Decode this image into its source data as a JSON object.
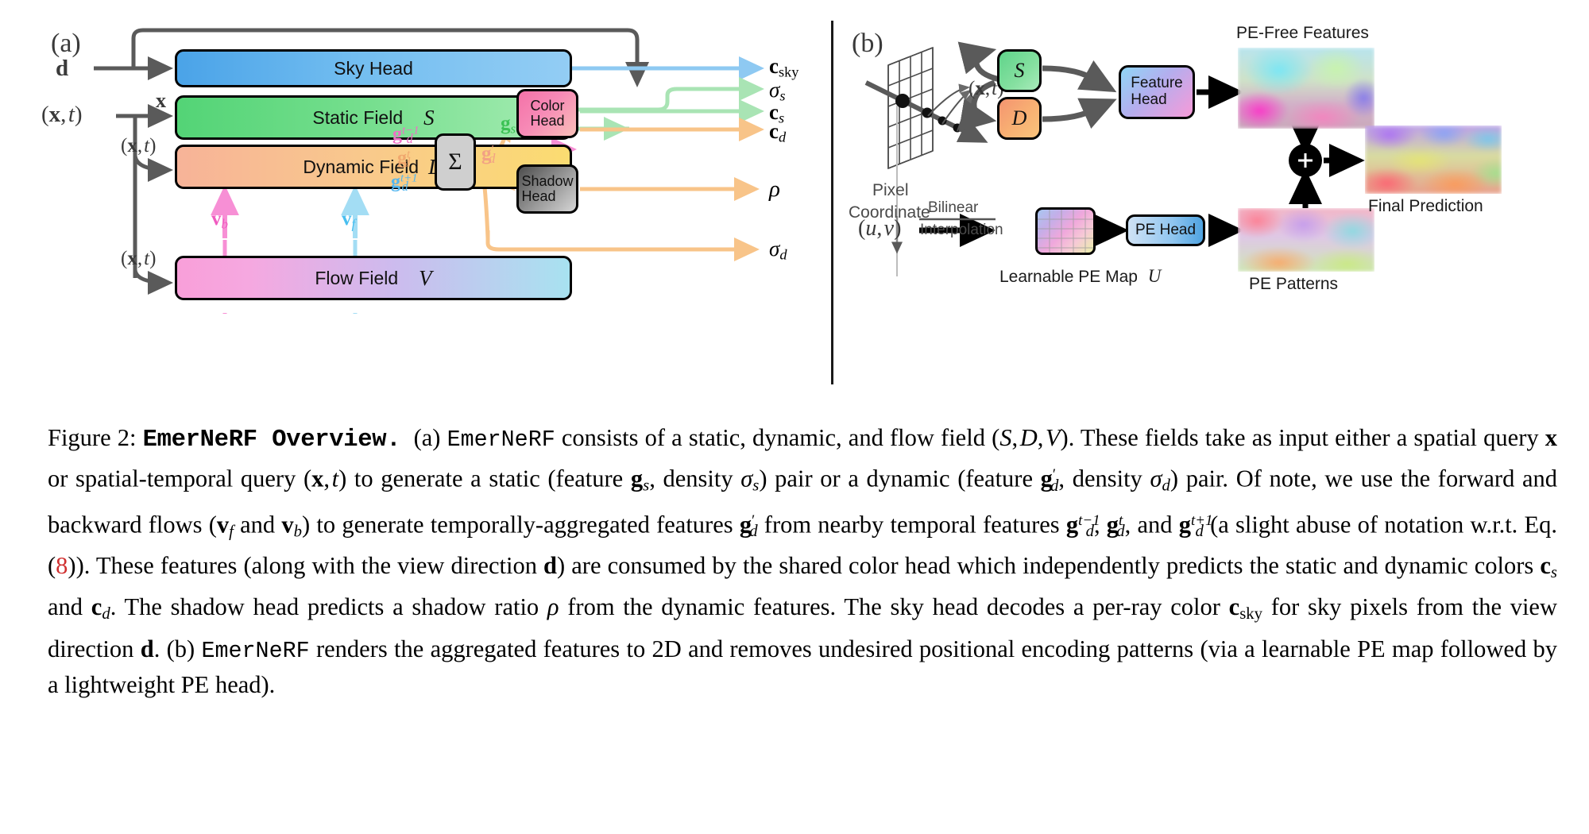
{
  "figure": {
    "panel_a": {
      "tag": "(a)",
      "inputs": [
        {
          "name": "direction",
          "latex": "d"
        },
        {
          "name": "spatio-temporal-query-static",
          "latex": "(x, t)"
        },
        {
          "name": "spatio-temporal-query-dynamic",
          "latex": "(x, t)"
        },
        {
          "name": "spatio-temporal-query-flow",
          "latex": "(x, t)"
        }
      ],
      "edge_labels": {
        "x_to_static": "x",
        "g_s": "g_s",
        "g_d_tm1": "g_d^{t-1}",
        "g_d_t": "g_d^{t}",
        "g_d_tp1": "g_d^{t+1}",
        "g_d_prime": "g'_d",
        "v_b": "v_b",
        "v_f": "v_f"
      },
      "boxes": [
        {
          "id": "sky-head",
          "label": "Sky Head",
          "symbol": ""
        },
        {
          "id": "static-field",
          "label": "Static Field",
          "symbol": "S"
        },
        {
          "id": "dynamic-field",
          "label": "Dynamic Field",
          "symbol": "D"
        },
        {
          "id": "flow-field",
          "label": "Flow Field",
          "symbol": "V"
        },
        {
          "id": "sigma-box",
          "label": "Σ",
          "symbol": ""
        },
        {
          "id": "color-head",
          "label": "Color Head",
          "symbol": ""
        },
        {
          "id": "shadow-head",
          "label": "Shadow Head",
          "symbol": ""
        }
      ],
      "outputs": [
        {
          "name": "c-sky",
          "base": "c",
          "sub": "sky"
        },
        {
          "name": "sigma-s",
          "base": "σ",
          "sub": "s"
        },
        {
          "name": "c-s",
          "base": "c",
          "sub": "s"
        },
        {
          "name": "c-d",
          "base": "c",
          "sub": "d"
        },
        {
          "name": "rho",
          "base": "ρ",
          "sub": ""
        },
        {
          "name": "sigma-d",
          "base": "σ",
          "sub": "d"
        }
      ]
    },
    "panel_b": {
      "tag": "(b)",
      "pixel_coordinate_label_line1": "Pixel",
      "pixel_coordinate_label_line2": "Coordinate",
      "sample_query_label": "(x, t)",
      "uv_label": "(u, v)",
      "bilinear_top": "Bilinear",
      "bilinear_bottom": "Interpolation",
      "boxes": [
        {
          "id": "b-static",
          "label": "S"
        },
        {
          "id": "b-dynamic",
          "label": "D"
        },
        {
          "id": "feature-head",
          "label": "Feature Head"
        },
        {
          "id": "pe-head",
          "label": "PE Head"
        }
      ],
      "image_captions": {
        "pe_free": "PE-Free Features",
        "final_prediction": "Final Prediction",
        "pe_patterns": "PE Patterns",
        "learnable_pe_map": "Learnable PE Map",
        "learnable_pe_map_symbol": "U"
      },
      "plus_symbol": "+"
    },
    "colors": {
      "sky_blue": "#7cc3f0",
      "static_green": "#77df8f",
      "dynamic_orange": "#f9c98c",
      "flow_pink": "#f89fd9",
      "color_head_pink": "#f478ac",
      "shadow_head_gray": "#8d8d8d",
      "arrow_gray": "#5a5a5a",
      "flow_backward_magenta": "#f77fce",
      "flow_forward_cyan": "#8fd9f4",
      "citation_red": "#d03030"
    }
  },
  "caption": {
    "figure_number": "Figure 2:",
    "title": "EmerNeRF Overview.",
    "text_parts": [
      "(a) ",
      "EmerNeRF",
      " consists of a static, dynamic, and flow field (",
      "S, D, V",
      "). These fields take as input either a spatial query ",
      "x",
      " or spatial-temporal query ",
      "(x, t)",
      " to generate a static (feature ",
      "g_s",
      ", density ",
      "σ_s",
      ") pair or a dynamic (feature ",
      "g'_d",
      ", density ",
      "σ_d",
      ") pair. Of note, we use the forward and backward flows (",
      "v_f",
      " and ",
      "v_b",
      ") to generate temporally-aggregated features ",
      "g'_d",
      " from nearby temporal features ",
      "g_d^{t-1}, g_d^{t}",
      ", and ",
      "g_d^{t+1}",
      " (a slight abuse of notation w.r.t. Eq. (",
      "8",
      ")). These features (along with the view direction ",
      "d",
      ") are consumed by the shared color head which independently predicts the static and dynamic colors ",
      "c_s",
      " and ",
      "c_d",
      ". The shadow head predicts a shadow ratio ",
      "ρ",
      " from the dynamic features. The sky head decodes a per-ray color ",
      "c_sky",
      " for sky pixels from the view direction ",
      "d",
      ". (b) ",
      "EmerNeRF",
      " renders the aggregated features to 2D and removes undesired positional encoding patterns (via a learnable PE map followed by a lightweight PE head)."
    ],
    "equation_reference": "8"
  }
}
